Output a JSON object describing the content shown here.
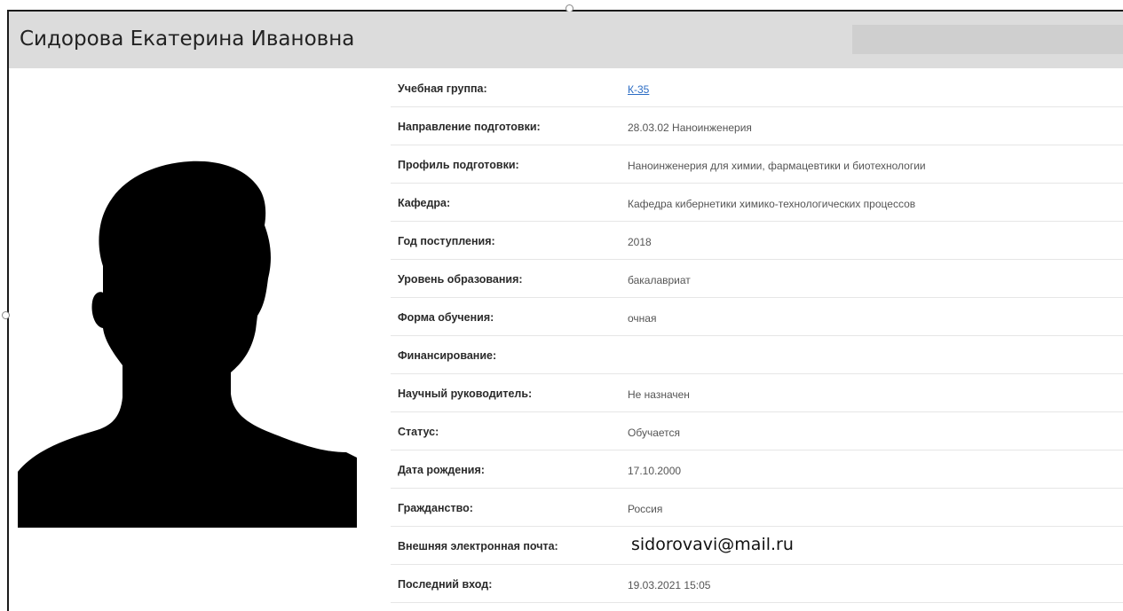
{
  "profile": {
    "full_name": "Сидорова Екатерина Ивановна"
  },
  "details": [
    {
      "label": "Учебная группа:",
      "value": "К-35",
      "is_link": true
    },
    {
      "label": "Направление подготовки:",
      "value": "28.03.02 Наноинженерия"
    },
    {
      "label": "Профиль подготовки:",
      "value": "Наноинженерия для химии, фармацевтики и биотехнологии"
    },
    {
      "label": "Кафедра:",
      "value": "Кафедра кибернетики химико-технологических процессов"
    },
    {
      "label": "Год поступления:",
      "value": "2018"
    },
    {
      "label": "Уровень образования:",
      "value": "бакалавриат"
    },
    {
      "label": "Форма обучения:",
      "value": "очная"
    },
    {
      "label": "Финансирование:",
      "value": ""
    },
    {
      "label": "Научный руководитель:",
      "value": "Не назначен"
    },
    {
      "label": "Статус:",
      "value": "Обучается"
    },
    {
      "label": "Дата рождения:",
      "value": "17.10.2000"
    },
    {
      "label": "Гражданство:",
      "value": "Россия"
    },
    {
      "label": "Внешняя электронная почта:",
      "value": "sidorovavi@mail.ru",
      "large": true
    },
    {
      "label": "Последний вход:",
      "value": "19.03.2021 15:05"
    }
  ],
  "colors": {
    "header_bg": "#dcdcdc",
    "link": "#2b6cc4",
    "silhouette": "#000000"
  },
  "icons": {
    "avatar": "person-silhouette-icon"
  }
}
